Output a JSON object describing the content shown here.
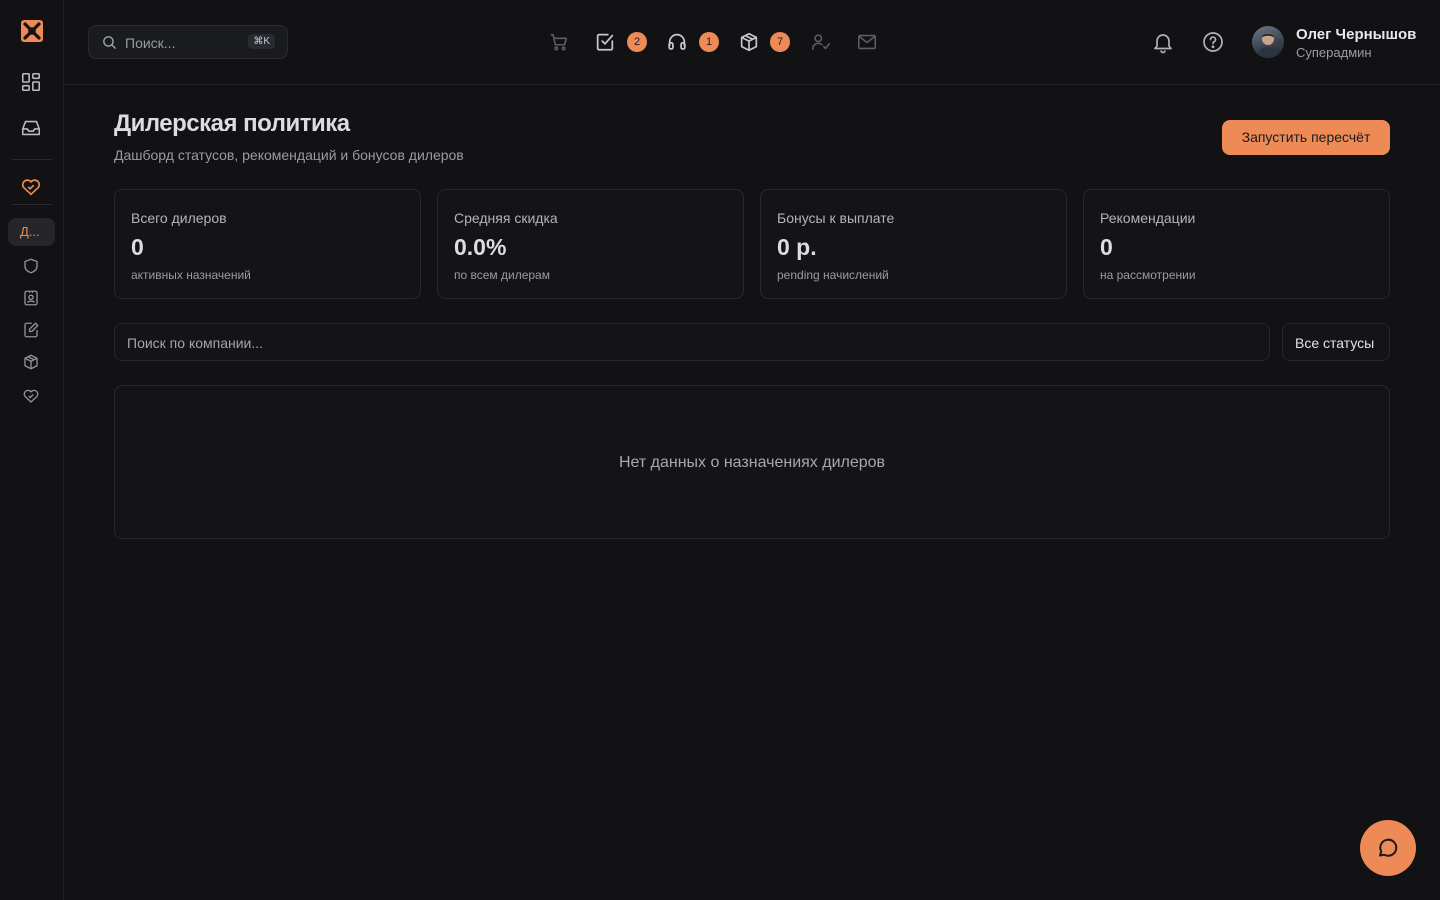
{
  "colors": {
    "accent": "#ee8a55",
    "background": "#121214",
    "card_border": "#27282d"
  },
  "sidebar": {
    "logo_icon": "x-logo-icon",
    "items": [
      {
        "icon": "dashboard-grid-icon"
      },
      {
        "icon": "inbox-icon"
      },
      {
        "icon": "handshake-heart-icon",
        "active": true
      }
    ],
    "sub_items": [
      {
        "label": "Д...",
        "active": true
      },
      {
        "icon": "shield-icon"
      },
      {
        "icon": "contact-badge-icon"
      },
      {
        "icon": "edit-document-icon"
      },
      {
        "icon": "boxes-icon"
      },
      {
        "icon": "handshake-heart-icon"
      }
    ]
  },
  "header": {
    "search": {
      "placeholder": "Поиск...",
      "shortcut": "⌘K"
    },
    "quick_icons": [
      {
        "icon": "cart-icon",
        "dimmed": true
      },
      {
        "icon": "checkbox-icon",
        "badge": "2"
      },
      {
        "icon": "headset-icon",
        "badge": "1"
      },
      {
        "icon": "package-icon",
        "badge": "7"
      },
      {
        "icon": "user-check-icon",
        "dimmed": true
      },
      {
        "icon": "mail-icon",
        "dimmed": true
      }
    ],
    "notifications_icon": "bell-icon",
    "help_icon": "help-circle-icon",
    "user": {
      "name": "Олег Чернышов",
      "role": "Суперадмин"
    }
  },
  "page": {
    "title": "Дилерская политика",
    "subtitle": "Дашборд статусов, рекомендаций и бонусов дилеров",
    "primary_action": "Запустить пересчёт"
  },
  "stats": [
    {
      "title": "Всего дилеров",
      "value": "0",
      "note": "активных назначений"
    },
    {
      "title": "Средняя скидка",
      "value": "0.0%",
      "note": "по всем дилерам"
    },
    {
      "title": "Бонусы к выплате",
      "value": "0 р.",
      "note": "pending начислений"
    },
    {
      "title": "Рекомендации",
      "value": "0",
      "note": "на рассмотрении"
    }
  ],
  "filters": {
    "company_search_placeholder": "Поиск по компании...",
    "status_filter": "Все статусы"
  },
  "empty_state": "Нет данных о назначениях дилеров",
  "chat_icon": "chat-bubble-icon"
}
